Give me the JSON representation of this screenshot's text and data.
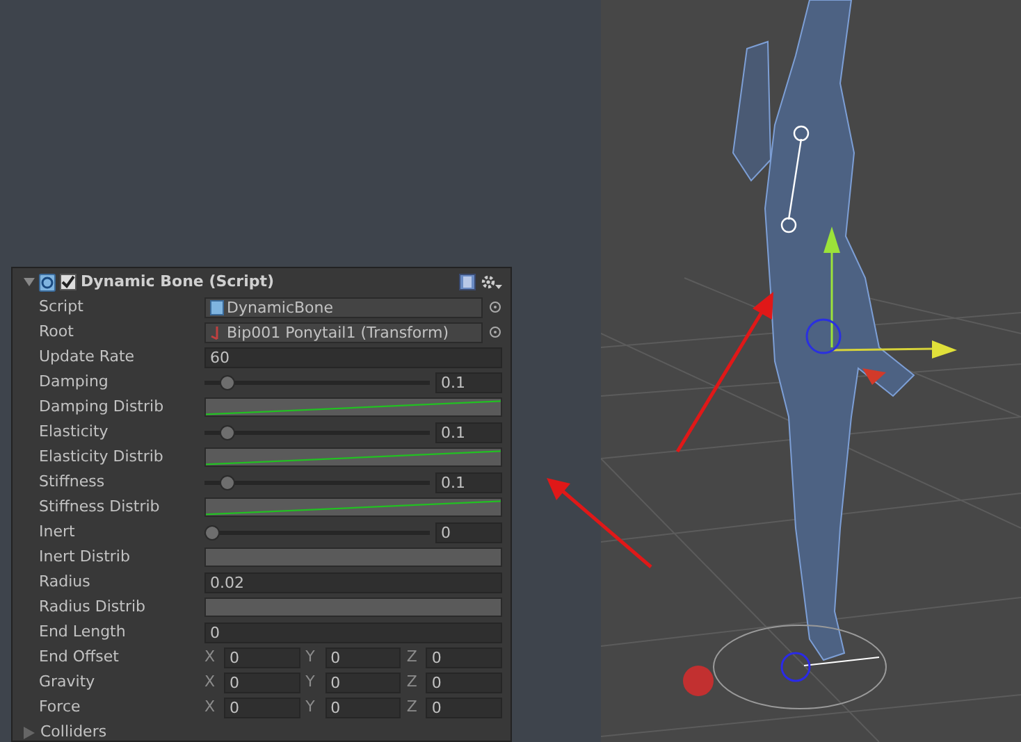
{
  "inspector": {
    "component": {
      "title": "Dynamic Bone (Script)",
      "expanded": true,
      "enabled": true
    },
    "fields": [
      {
        "kind": "object",
        "label": "Script",
        "value": "DynamicBone"
      },
      {
        "kind": "object",
        "label": "Root",
        "value": "Bip001 Ponytail1 (Transform)"
      },
      {
        "kind": "text",
        "label": "Update Rate",
        "value": "60"
      },
      {
        "kind": "slider",
        "label": "Damping",
        "level": 0.1,
        "value": "0.1"
      },
      {
        "kind": "curve",
        "label": "Damping Distrib",
        "curve": true
      },
      {
        "kind": "slider",
        "label": "Elasticity",
        "level": 0.1,
        "value": "0.1"
      },
      {
        "kind": "curve",
        "label": "Elasticity Distrib",
        "curve": true
      },
      {
        "kind": "slider",
        "label": "Stiffness",
        "level": 0.1,
        "value": "0.1"
      },
      {
        "kind": "curve",
        "label": "Stiffness Distrib",
        "curve": true
      },
      {
        "kind": "slider",
        "label": "Inert",
        "level": 0,
        "value": "0"
      },
      {
        "kind": "curve",
        "label": "Inert Distrib",
        "curve": false
      },
      {
        "kind": "text",
        "label": "Radius",
        "value": "0.02"
      },
      {
        "kind": "curve",
        "label": "Radius Distrib",
        "curve": false
      },
      {
        "kind": "text",
        "label": "End Length",
        "value": "0"
      },
      {
        "kind": "vector",
        "label": "End Offset",
        "axes": [
          {
            "axis": "X",
            "value": "0"
          },
          {
            "axis": "Y",
            "value": "0"
          },
          {
            "axis": "Z",
            "value": "0"
          }
        ]
      },
      {
        "kind": "vector",
        "label": "Gravity",
        "axes": [
          {
            "axis": "X",
            "value": "0"
          },
          {
            "axis": "Y",
            "value": "0"
          },
          {
            "axis": "Z",
            "value": "0"
          }
        ]
      },
      {
        "kind": "vector",
        "label": "Force",
        "axes": [
          {
            "axis": "X",
            "value": "0"
          },
          {
            "axis": "Y",
            "value": "0"
          },
          {
            "axis": "Z",
            "value": "0"
          }
        ]
      },
      {
        "kind": "foldout",
        "label": "Colliders",
        "expanded": false
      }
    ]
  }
}
